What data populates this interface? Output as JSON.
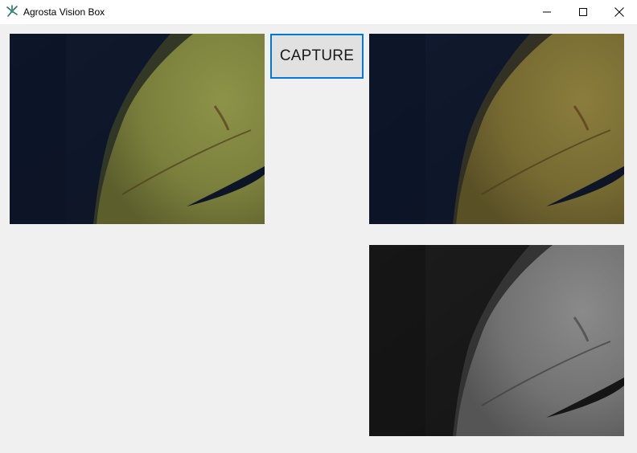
{
  "window": {
    "title": "Agrosta Vision Box",
    "app_icon": "agrosta-leaf-icon",
    "controls": [
      "minimize-icon",
      "maximize-icon",
      "close-icon"
    ]
  },
  "toolbar": {
    "capture_label": "CAPTURE"
  },
  "frames": {
    "live": {
      "image": "live-camera-feed",
      "subject": "banana",
      "mode": "color"
    },
    "captured": {
      "image": "captured-color-frame",
      "subject": "banana",
      "mode": "color"
    },
    "grayscale": {
      "image": "captured-grayscale-frame",
      "subject": "banana",
      "mode": "grayscale"
    }
  },
  "colors": {
    "accent": "#0078d7",
    "window_bg": "#f0f0f0",
    "titlebar_bg": "#ffffff"
  }
}
